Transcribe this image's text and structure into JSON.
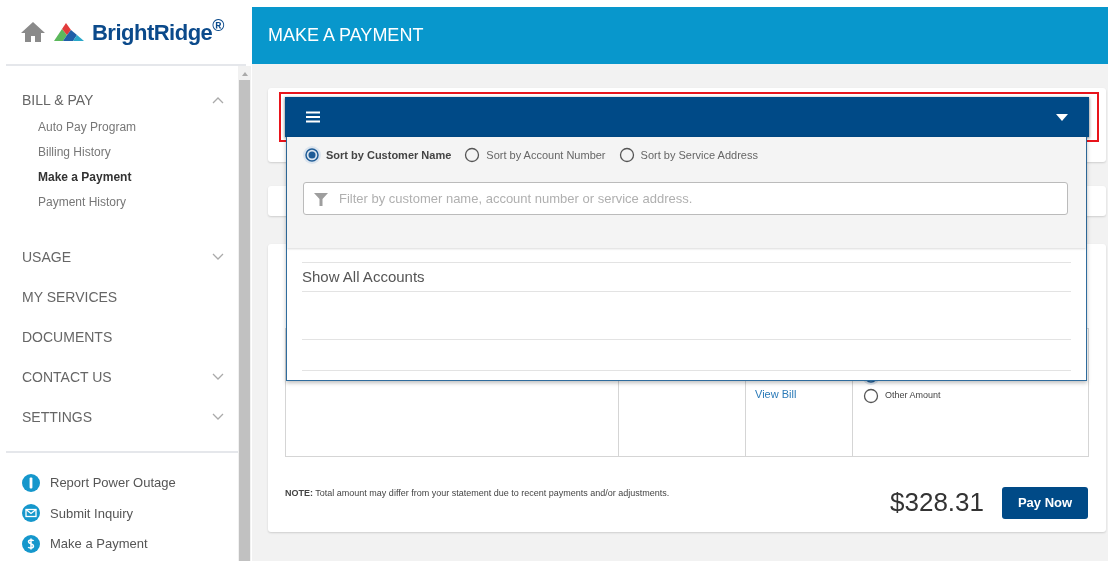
{
  "logo": {
    "brand": "BrightRidge$^{®}$"
  },
  "sidebar": {
    "items": [
      {
        "label": "BILL & PAY",
        "kind": "group",
        "expanded": true,
        "children": [
          {
            "label": "Auto Pay Program",
            "selected": false
          },
          {
            "label": "Billing History",
            "selected": false
          },
          {
            "label": "Make a Payment",
            "selected": true
          },
          {
            "label": "Payment History",
            "selected": false
          }
        ]
      },
      {
        "label": "USAGE",
        "kind": "group",
        "expanded": false
      },
      {
        "label": "MY SERVICES",
        "kind": "link"
      },
      {
        "label": "DOCUMENTS",
        "kind": "link"
      },
      {
        "label": "CONTACT US",
        "kind": "group",
        "expanded": false
      },
      {
        "label": "SETTINGS",
        "kind": "group",
        "expanded": false
      }
    ],
    "quick_links": [
      {
        "label": "Report Power Outage",
        "kind": "alert"
      },
      {
        "label": "Submit Inquiry",
        "kind": "mail"
      },
      {
        "label": "Make a Payment",
        "kind": "dollar"
      }
    ]
  },
  "page_title": "MAKE A PAYMENT",
  "account_selector": {
    "expanded": true,
    "highlighted": true,
    "sort_options": [
      {
        "label": "Sort by Customer Name",
        "selected": true
      },
      {
        "label": "Sort by Account Number",
        "selected": false
      },
      {
        "label": "Sort by Service Address",
        "selected": false
      }
    ],
    "filter": {
      "placeholder": "Filter by customer name, account number or service address."
    },
    "options": [
      "Show All Accounts"
    ]
  },
  "bill_table": {
    "link": "View Bill",
    "payment_options": [
      {
        "selected": true
      },
      {
        "label": "Other Amount",
        "selected": false
      }
    ]
  },
  "note": "**NOTE:** Total amount may differ from your statement due to recent payments and/or adjustments.",
  "total": "$328.31",
  "pay_button": "Pay Now"
}
